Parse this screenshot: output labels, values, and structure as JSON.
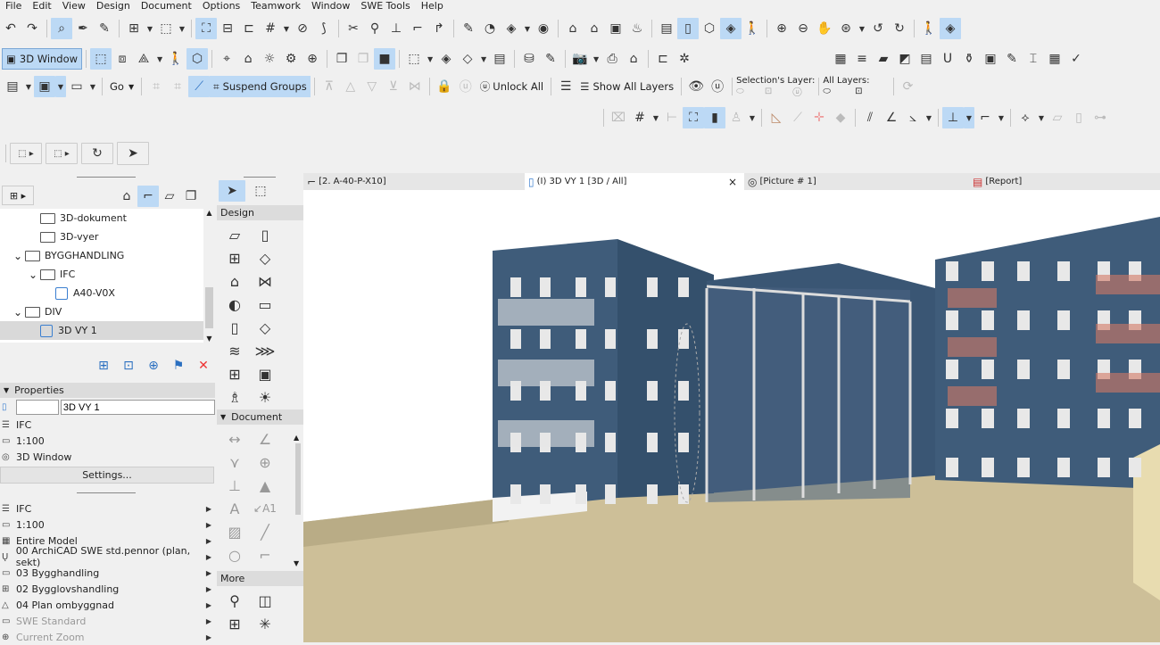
{
  "menu": [
    "File",
    "Edit",
    "View",
    "Design",
    "Document",
    "Options",
    "Teamwork",
    "Window",
    "SWE Tools",
    "Help"
  ],
  "toolbar": {
    "row1_icons": [
      "undo-icon",
      "redo-icon",
      "separator",
      "find-select-icon",
      "eyedropper-icon",
      "syringe-icon",
      "separator",
      "group-icon",
      "dd",
      "marquee-icon",
      "dd",
      "separator",
      "trace-icon",
      "trace-reference-icon",
      "drawing-frame-icon",
      "grid-icon",
      "dd",
      "layer-icon",
      "fix-icon",
      "separator",
      "magic-wand-icon",
      "explode-icon",
      "trim-icon",
      "offset-icon",
      "adjust-icon",
      "separator",
      "pencil-icon",
      "shape-icon",
      "material-icon",
      "dd",
      "globe-icon",
      "separator",
      "bim-server-icon",
      "home-icon",
      "home-frame-icon",
      "solar-icon",
      "separator",
      "plan-icon",
      "3d-window-icon",
      "cube-icon",
      "perspective-icon",
      "walk-icon",
      "separator",
      "zoom-in-icon",
      "zoom-out-icon",
      "pan-icon",
      "fit-icon",
      "dd",
      "previous-zoom-icon",
      "next-zoom-icon",
      "separator",
      "walk-person-icon",
      "orbit-icon"
    ],
    "view_button": "3D Window",
    "go_label": "Go",
    "suspend_groups": "Suspend Groups",
    "unlock_all": "Unlock All",
    "show_all_layers": "Show All Layers",
    "selections_layer": "Selection's Layer:",
    "all_layers": "All Layers:"
  },
  "tabs": [
    {
      "label": "[2. A-40-P-X10]",
      "icon": "plan-icon"
    },
    {
      "label": "(I) 3D VY 1 [3D / All]",
      "icon": "3d-view-icon",
      "active": true,
      "close": "×"
    },
    {
      "label": "[Picture # 1]",
      "icon": "camera-icon"
    },
    {
      "label": "[Report]",
      "icon": "report-icon"
    }
  ],
  "navigator": {
    "items": [
      {
        "label": "3D-dokument",
        "type": "folder",
        "level": 2
      },
      {
        "label": "3D-vyer",
        "type": "folder",
        "level": 2
      },
      {
        "label": "BYGGHANDLING",
        "type": "folder",
        "level": 1,
        "expanded": true
      },
      {
        "label": "IFC",
        "type": "folder",
        "level": 2,
        "expanded": true
      },
      {
        "label": "A40-V0X",
        "type": "view",
        "level": 3
      },
      {
        "label": "DIV",
        "type": "folder",
        "level": 1,
        "expanded": true
      },
      {
        "label": "3D VY 1",
        "type": "view",
        "level": 2,
        "selected": true
      }
    ]
  },
  "properties": {
    "title": "Properties",
    "id_value": "",
    "name_value": "3D VY 1",
    "layer": "IFC",
    "scale": "1:100",
    "type": "3D Window",
    "settings_button": "Settings...",
    "list": [
      {
        "label": "IFC",
        "icon": "layer-combo-icon"
      },
      {
        "label": "1:100",
        "icon": "scale-icon"
      },
      {
        "label": "Entire Model",
        "icon": "structure-icon"
      },
      {
        "label": "00 ArchiCAD SWE std.pennor (plan, sekt)",
        "icon": "pen-set-icon"
      },
      {
        "label": "03 Bygghandling",
        "icon": "mvo-icon"
      },
      {
        "label": "02 Bygglovshandling",
        "icon": "renovation-icon"
      },
      {
        "label": "04 Plan ombyggnad",
        "icon": "renovation-filter-icon"
      },
      {
        "label": "SWE Standard",
        "icon": "dimension-icon",
        "disabled": true
      },
      {
        "label": "Current Zoom",
        "icon": "zoom-icon",
        "disabled": true
      }
    ]
  },
  "toolbox": {
    "design": "Design",
    "document": "Document",
    "more": "More"
  },
  "colors": {
    "accent": "#bcd9f5",
    "building": "#3e5a78",
    "ground": "#cfc29c"
  }
}
